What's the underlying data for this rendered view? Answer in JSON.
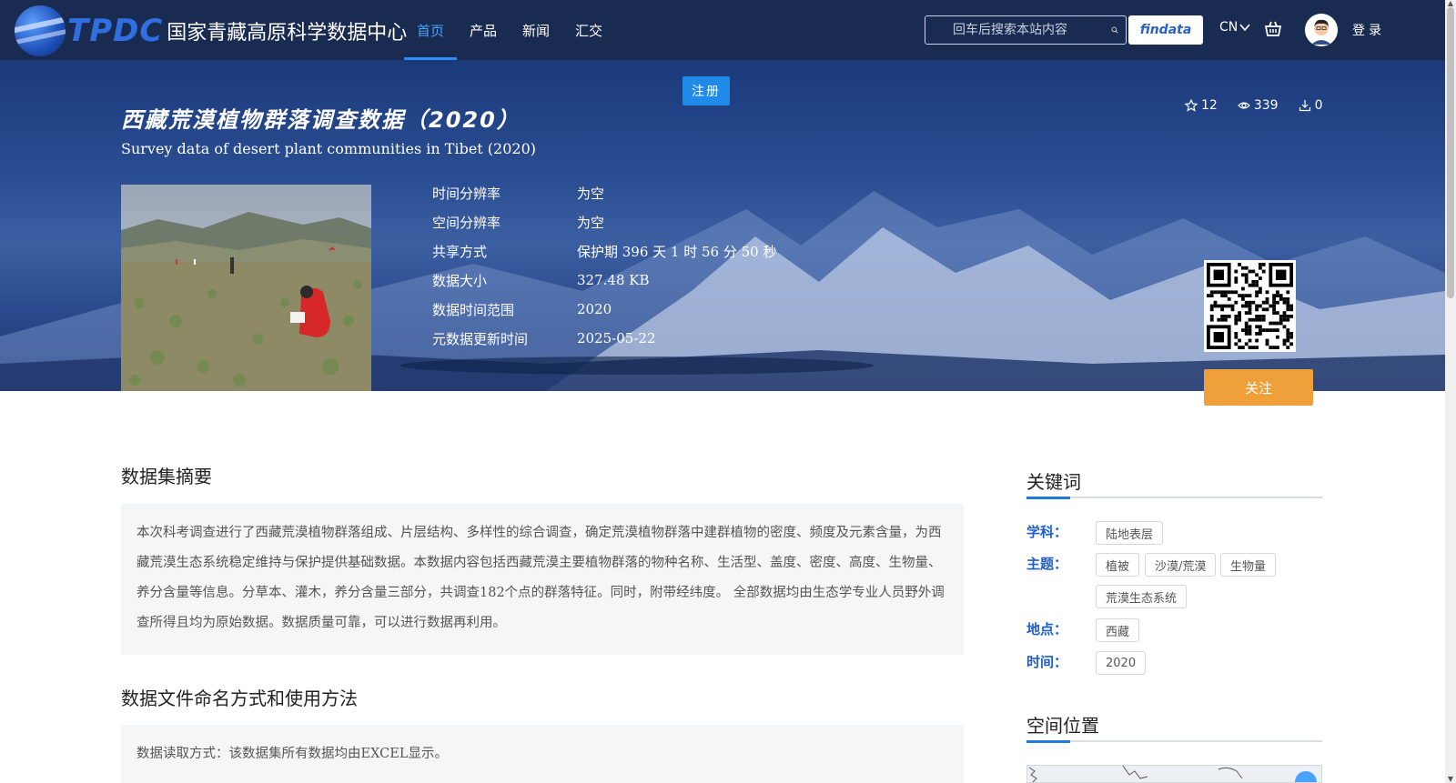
{
  "header": {
    "logo_text": "TPDC",
    "logo_cn": "国家青藏高原科学数据中心",
    "nav": [
      {
        "label": "首页",
        "active": true
      },
      {
        "label": "产品",
        "active": false
      },
      {
        "label": "新闻",
        "active": false
      },
      {
        "label": "汇交",
        "active": false
      }
    ],
    "search_placeholder": "回车后搜索本站内容",
    "findata_label": "findata",
    "lang": "CN",
    "login": "登录"
  },
  "banner": {
    "register": "注册",
    "title_cn": "西藏荒漠植物群落调查数据（2020）",
    "title_en": "Survey data of desert plant communities in Tibet (2020)",
    "stats": {
      "stars": "12",
      "views": "339",
      "downloads": "0"
    },
    "info": [
      {
        "label": "时间分辨率",
        "value": "为空"
      },
      {
        "label": "空间分辨率",
        "value": "为空"
      },
      {
        "label": "共享方式",
        "value": "保护期 396 天 1 时 56 分 50 秒"
      },
      {
        "label": "数据大小",
        "value": "327.48 KB"
      },
      {
        "label": "数据时间范围",
        "value": "2020"
      },
      {
        "label": "元数据更新时间",
        "value": "2025-05-22"
      }
    ],
    "follow": "关注"
  },
  "main": {
    "abstract_title": "数据集摘要",
    "abstract_text": "本次科考调查进行了西藏荒漠植物群落组成、片层结构、多样性的综合调查，确定荒漠植物群落中建群植物的密度、频度及元素含量，为西藏荒漠生态系统稳定维持与保护提供基础数据。本数据内容包括西藏荒漠主要植物群落的物种名称、生活型、盖度、密度、高度、生物量、养分含量等信息。分草本、灌木，养分含量三部分，共调查182个点的群落特征。同时，附带经纬度。 全部数据均由生态学专业人员野外调查所得且均为原始数据。数据质量可靠，可以进行数据再利用。",
    "naming_title": "数据文件命名方式和使用方法",
    "naming_text": "数据读取方式：该数据集所有数据均由EXCEL显示。"
  },
  "sidebar": {
    "keywords_title": "关键词",
    "subject_label": "学科：",
    "subject_tags": [
      "陆地表层"
    ],
    "theme_label": "主题：",
    "theme_tags": [
      "植被",
      "沙漠/荒漠",
      "生物量",
      "荒漠生态系统"
    ],
    "place_label": "地点：",
    "place_tags": [
      "西藏"
    ],
    "time_label": "时间：",
    "time_tags": [
      "2020"
    ],
    "location_title": "空间位置"
  }
}
